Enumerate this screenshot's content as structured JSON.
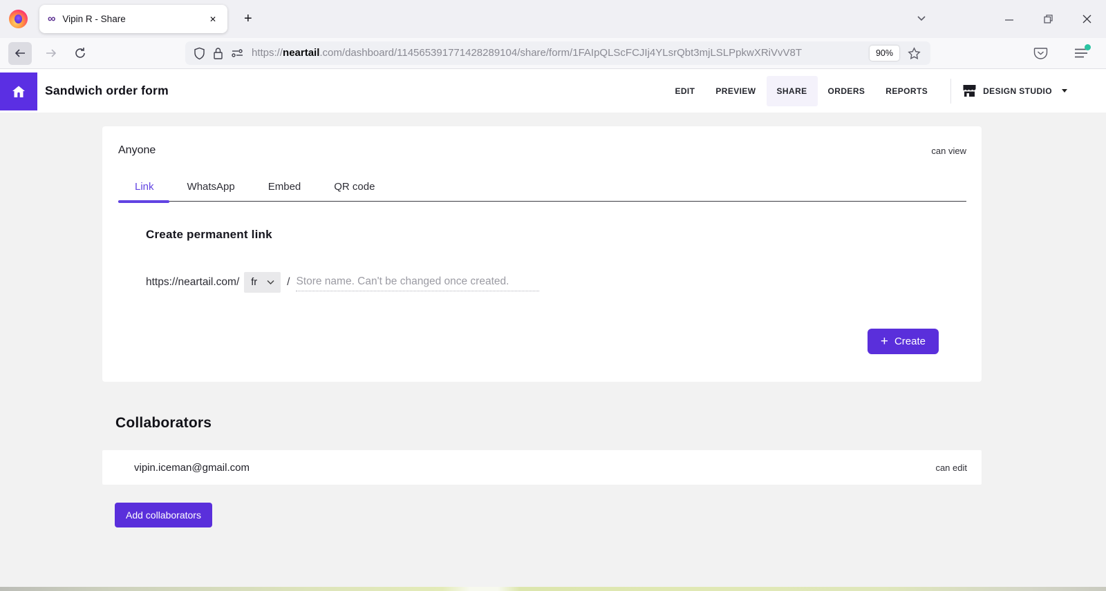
{
  "browser": {
    "tab_title": "Vipin R - Share",
    "favicon_glyph": "∞",
    "url_protocol": "https://",
    "url_domain": "neartail",
    "url_rest": ".com/dashboard/114565391771428289104/share/form/1FAIpQLScFCJIj4YLsrQbt3mjLSLPpkwXRiVvV8T",
    "zoom_level": "90%",
    "new_tab_glyph": "+",
    "tab_close_glyph": "✕"
  },
  "header": {
    "title": "Sandwich order form",
    "nav": [
      "EDIT",
      "PREVIEW",
      "SHARE",
      "ORDERS",
      "REPORTS"
    ],
    "active_nav": "SHARE",
    "account_label": "DESIGN STUDIO"
  },
  "share": {
    "audience_label": "Anyone",
    "audience_permission": "can view",
    "tabs": [
      "Link",
      "WhatsApp",
      "Embed",
      "QR code"
    ],
    "active_tab": "Link",
    "create_link_title": "Create permanent link",
    "base_url": "https://neartail.com/",
    "locale": "fr",
    "path_separator": "/",
    "store_name_placeholder": "Store name. Can't be changed once created.",
    "create_button_icon": "+",
    "create_button_label": "Create"
  },
  "collaborators": {
    "title": "Collaborators",
    "list": [
      {
        "email": "vipin.iceman@gmail.com",
        "permission": "can edit"
      }
    ],
    "add_button_label": "Add collaborators"
  },
  "colors": {
    "accent": "#5a2fdb",
    "active_tab_text": "#6143e2",
    "home_square": "#5b2fe3",
    "page_bg": "#f2f2f2",
    "notification_dot": "#2ac3a2"
  }
}
